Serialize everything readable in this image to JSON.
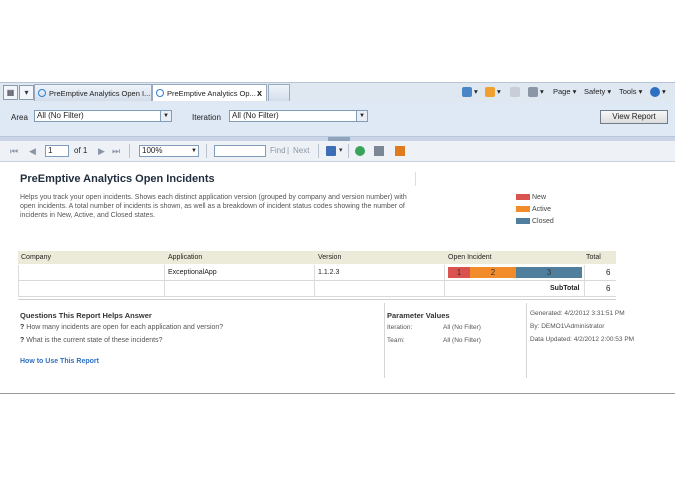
{
  "browser": {
    "tabs": [
      {
        "label": "PreEmptive Analytics Open I..."
      },
      {
        "label": "PreEmptive Analytics Op...",
        "close": "x"
      }
    ],
    "commands": {
      "page": "Page",
      "safety": "Safety",
      "tools": "Tools"
    }
  },
  "params": {
    "area_label": "Area",
    "area_value": "All (No Filter)",
    "iteration_label": "Iteration",
    "iteration_value": "All (No Filter)",
    "view_report": "View Report"
  },
  "report_toolbar": {
    "page_number": "1",
    "of_pages": "of 1",
    "zoom": "100%",
    "find": "Find",
    "separator": "|",
    "next": "Next"
  },
  "report": {
    "title": "PreEmptive Analytics Open Incidents",
    "description": "Helps you track your open incidents. Shows each distinct application version (grouped by company and version number) with open incidents. A total number of incidents is shown, as well as a breakdown of incident status codes showing the number of incidents in New, Active, and Closed states.",
    "legend": [
      {
        "label": "New",
        "color": "#d9534f"
      },
      {
        "label": "Active",
        "color": "#f28c2a"
      },
      {
        "label": "Closed",
        "color": "#4f7f9c"
      }
    ],
    "table": {
      "headers": {
        "company": "Company",
        "application": "Application",
        "version": "Version",
        "open_incident": "Open Incident",
        "total": "Total"
      },
      "rows": [
        {
          "company": "",
          "application": "ExceptionalApp",
          "version": "1.1.2.3",
          "new": "1",
          "active": "2",
          "closed": "3",
          "total": "6"
        }
      ],
      "subtotal_label": "SubTotal",
      "subtotal_value": "6"
    },
    "questions": {
      "title": "Questions This Report Helps Answer",
      "items": [
        "How many incidents are open for each application and version?",
        "What is the current state of these incidents?"
      ],
      "howto": "How to Use This Report"
    },
    "parameter_values": {
      "title": "Parameter Values",
      "items": [
        {
          "label": "Iteration:",
          "value": "All (No Filter)"
        },
        {
          "label": "Team:",
          "value": "All (No Filter)"
        }
      ]
    },
    "meta": {
      "generated": "Generated: 4/2/2012 3:31:51 PM",
      "by": "By: DEMO1\\Administrator",
      "updated": "Data Updated: 4/2/2012 2:00:53 PM"
    }
  }
}
